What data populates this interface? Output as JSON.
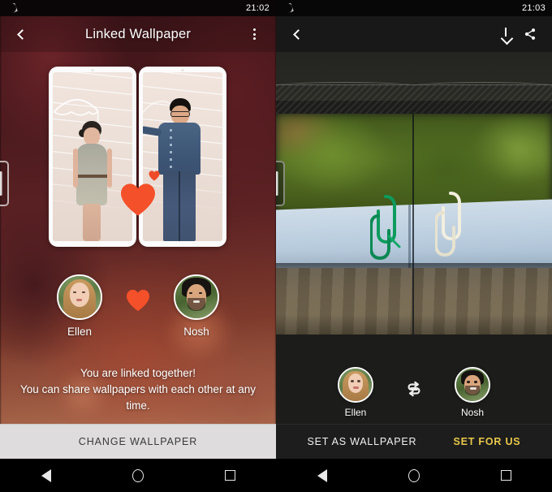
{
  "left": {
    "statusbar": {
      "dnd_icon": "crescent-moon-icon",
      "time": "21:02"
    },
    "appbar": {
      "back_icon": "chevron-left-icon",
      "title": "Linked Wallpaper",
      "menu_icon": "overflow-menu-icon"
    },
    "preview": {
      "description": "two-phone-mockup-split-wallpaper",
      "heart_icon": "heart-icon",
      "heart_color": "#f4502a"
    },
    "users": [
      {
        "name": "Ellen",
        "avatar": "ellen-avatar"
      },
      {
        "name": "Nosh",
        "avatar": "nosh-avatar"
      }
    ],
    "link_heart_icon": "heart-icon",
    "info_line1": "You are linked together!",
    "info_line2": "You can share wallpapers with each other at any",
    "info_line3": "time.",
    "cta_label": "CHANGE WALLPAPER",
    "edge_handle": "drawer-handle"
  },
  "right": {
    "statusbar": {
      "dnd_icon": "crescent-moon-icon",
      "time": "21:03"
    },
    "appbar": {
      "back_icon": "chevron-left-icon",
      "download_icon": "download-icon",
      "share_icon": "share-icon"
    },
    "preview": {
      "description": "paperclips-on-book-photo-split-preview"
    },
    "users": [
      {
        "name": "Ellen",
        "avatar": "ellen-avatar"
      },
      {
        "name": "Nosh",
        "avatar": "nosh-avatar"
      }
    ],
    "swap_icon": "swap-icon",
    "cta_primary": "SET AS WALLPAPER",
    "cta_secondary": "SET FOR US",
    "cta_secondary_color": "#e8c84a",
    "edge_handle": "drawer-handle"
  },
  "navbar": {
    "back_icon": "nav-back-triangle-icon",
    "home_icon": "nav-home-circle-icon",
    "recents_icon": "nav-recents-square-icon"
  }
}
